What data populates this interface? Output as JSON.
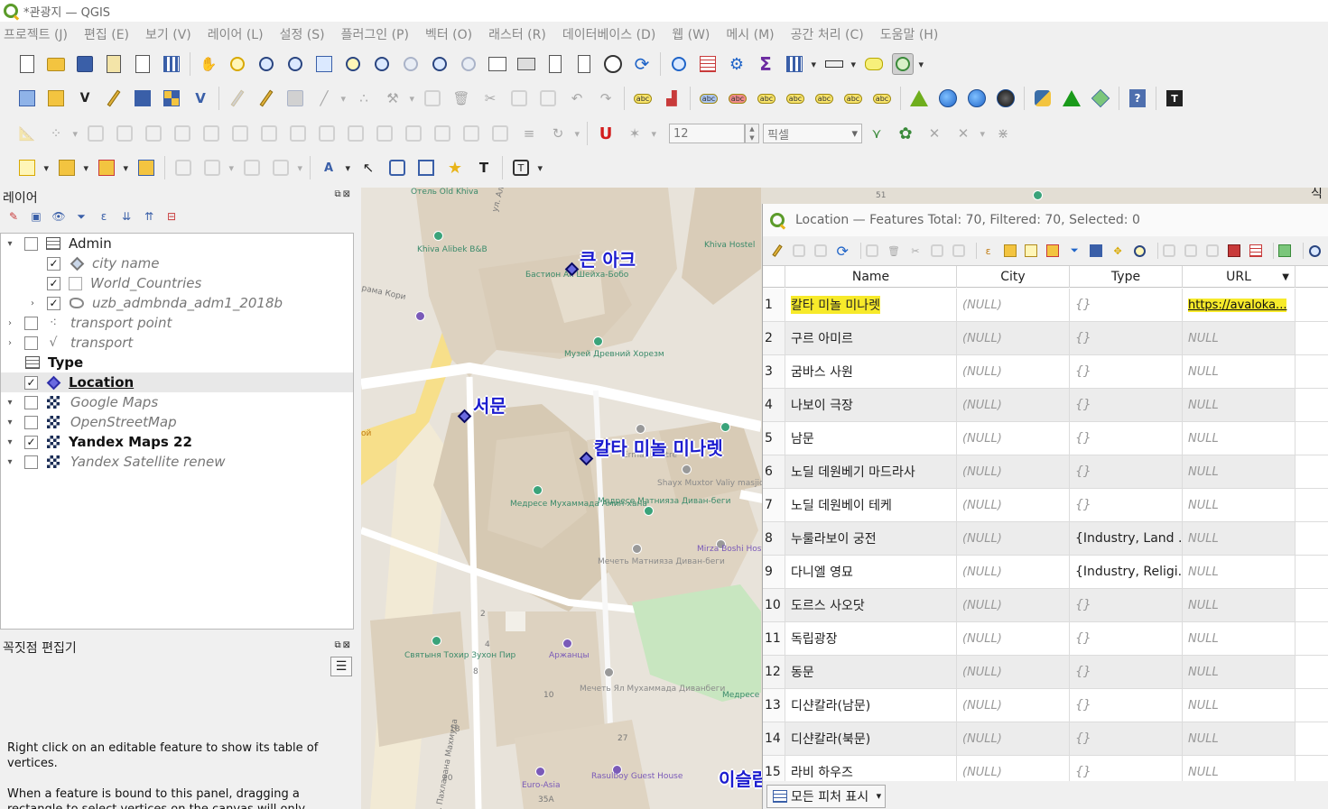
{
  "window": {
    "title": "*관광지 — QGIS"
  },
  "menu": [
    "프로젝트 (J)",
    "편집 (E)",
    "보기 (V)",
    "레이어 (L)",
    "설정 (S)",
    "플러그인 (P)",
    "벡터 (O)",
    "래스터 (R)",
    "데이터베이스 (D)",
    "웹 (W)",
    "메시 (M)",
    "공간 처리 (C)",
    "도움말 (H)"
  ],
  "toolbar": {
    "snap_tolerance": "12",
    "snap_units": "픽셀"
  },
  "layers_panel": {
    "title": "레이어",
    "layers": [
      {
        "name": "Admin",
        "checked": false,
        "style": "normal"
      },
      {
        "name": "city name",
        "checked": true,
        "style": "italic"
      },
      {
        "name": "World_Countries",
        "checked": false,
        "style": "italic"
      },
      {
        "name": "uzb_admbnda_adm1_2018b",
        "checked": true,
        "style": "italic"
      },
      {
        "name": "transport point",
        "checked": false,
        "style": "italic"
      },
      {
        "name": "transport",
        "checked": false,
        "style": "italic"
      },
      {
        "name": "Type",
        "checked": null,
        "style": "bold"
      },
      {
        "name": "Location",
        "checked": true,
        "style": "bold-underline"
      },
      {
        "name": "Google Maps",
        "checked": false,
        "style": "italic"
      },
      {
        "name": "OpenStreetMap",
        "checked": false,
        "style": "italic"
      },
      {
        "name": "Yandex Maps 22",
        "checked": true,
        "style": "bold"
      },
      {
        "name": "Yandex Satellite renew",
        "checked": false,
        "style": "italic"
      }
    ]
  },
  "vertex_editor": {
    "title": "꼭짓점 편집기",
    "help1": "Right click on an editable feature to show its table of vertices.",
    "help2": "When a feature is bound to this panel, dragging a rectangle to select vertices on the canvas will only"
  },
  "map": {
    "labels": [
      "큰 아크",
      "서문",
      "칼타 미놀 미나렛",
      "이슬람"
    ],
    "small_labels": [
      "Отель Old Khiva",
      "Khiva Alibek B&B",
      "Бастион Ак Шейха-Бобо",
      "Khiva Hostel",
      "Музей Древний Хорезм",
      "Медресе Мухаммада Амин-хана",
      "Медресе Матниязa Диван-беги",
      "Shayx Muxtor Valiy masjidi",
      "Mirza Boshi Hostel",
      "Мечеть Матниязa Диван-беги",
      "Ermat Centre",
      "Святыня Тохир Зухон Пир",
      "Аржанцы",
      "Мечеть Ял Мухаммада Диванбеги",
      "Медресе Якуббая Хо",
      "Euro-Asia",
      "Rasulboy Guest House",
      "ул. Ал",
      "рама Кори",
      "ой",
      "51",
      "2",
      "4",
      "8",
      "10",
      "18",
      "20",
      "27",
      "35A",
      "ул. Пахлавана Махмуда"
    ],
    "corner_label": "식"
  },
  "attribute_table": {
    "title": "Location — Features Total: 70, Filtered: 70, Selected: 0",
    "columns": [
      "Name",
      "City",
      "Type",
      "URL"
    ],
    "rows": [
      {
        "num": "1",
        "name": "칼타 미놀 미나렛",
        "city": "(NULL)",
        "type": "{}",
        "url": "https://avaloka...",
        "highlight": true
      },
      {
        "num": "2",
        "name": "구르 아미르",
        "city": "(NULL)",
        "type": "{}",
        "url": "NULL"
      },
      {
        "num": "3",
        "name": "굼바스 사원",
        "city": "(NULL)",
        "type": "{}",
        "url": "NULL"
      },
      {
        "num": "4",
        "name": "나보이 극장",
        "city": "(NULL)",
        "type": "{}",
        "url": "NULL"
      },
      {
        "num": "5",
        "name": "남문",
        "city": "(NULL)",
        "type": "{}",
        "url": "NULL"
      },
      {
        "num": "6",
        "name": "노딜 데원베기 마드라사",
        "city": "(NULL)",
        "type": "{}",
        "url": "NULL"
      },
      {
        "num": "7",
        "name": "노딜 데원베이 테케",
        "city": "(NULL)",
        "type": "{}",
        "url": "NULL"
      },
      {
        "num": "8",
        "name": "누룰라보이 궁전",
        "city": "(NULL)",
        "type": "{Industry, Land ...",
        "url": "NULL"
      },
      {
        "num": "9",
        "name": "다니엘 영묘",
        "city": "(NULL)",
        "type": "{Industry, Religi...",
        "url": "NULL"
      },
      {
        "num": "10",
        "name": "도르스 사오닷",
        "city": "(NULL)",
        "type": "{}",
        "url": "NULL"
      },
      {
        "num": "11",
        "name": "독립광장",
        "city": "(NULL)",
        "type": "{}",
        "url": "NULL"
      },
      {
        "num": "12",
        "name": "동문",
        "city": "(NULL)",
        "type": "{}",
        "url": "NULL"
      },
      {
        "num": "13",
        "name": "디샨칼라(남문)",
        "city": "(NULL)",
        "type": "{}",
        "url": "NULL"
      },
      {
        "num": "14",
        "name": "디샨칼라(북문)",
        "city": "(NULL)",
        "type": "{}",
        "url": "NULL"
      },
      {
        "num": "15",
        "name": "라비 하우즈",
        "city": "(NULL)",
        "type": "{}",
        "url": "NULL"
      }
    ],
    "footer_button": "모든 피처 표시"
  }
}
